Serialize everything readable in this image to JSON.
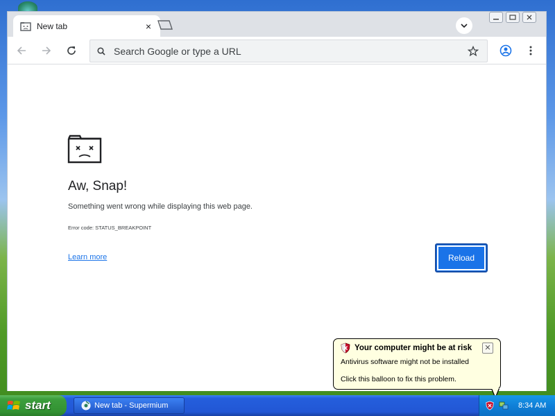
{
  "browser": {
    "tab_title": "New tab",
    "omnibox_placeholder": "Search Google or type a URL"
  },
  "error_page": {
    "title": "Aw, Snap!",
    "message": "Something went wrong while displaying this web page.",
    "error_code": "Error code: STATUS_BREAKPOINT",
    "learn_more": "Learn more",
    "reload": "Reload"
  },
  "balloon": {
    "title": "Your computer might be at risk",
    "line1": "Antivirus software might not be installed",
    "line2": "Click this balloon to fix this problem.",
    "close": "✕"
  },
  "taskbar": {
    "start_label": "start",
    "task_item": "New tab - Supermium",
    "clock": "8:34 AM"
  },
  "colors": {
    "accent": "#1a73e8",
    "balloon_bg": "#ffffe1",
    "taskbar_blue": "#245edc",
    "start_green": "#3c9e3c"
  },
  "icons": [
    "desktop-icon",
    "sad-tab-favicon",
    "close-icon",
    "new-tab-icon",
    "chevron-down-icon",
    "back-arrow-icon",
    "forward-arrow-icon",
    "reload-icon",
    "search-icon",
    "star-icon",
    "profile-icon",
    "kebab-menu-icon",
    "sad-tab-icon",
    "security-shield-icon",
    "windows-logo-icon",
    "supermium-icon",
    "network-icon"
  ]
}
